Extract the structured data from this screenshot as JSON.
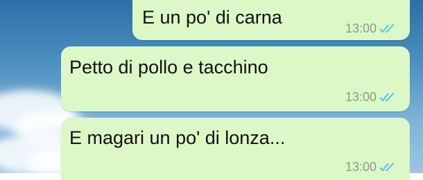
{
  "messages": [
    {
      "text": "E un po' di carna",
      "time": "13:00",
      "status_icon": "double-check-icon"
    },
    {
      "text": "Petto di pollo e tacchino",
      "time": "13:00",
      "status_icon": "double-check-icon"
    },
    {
      "text": "E magari un po' di lonza...",
      "time": "13:00",
      "status_icon": "double-check-icon"
    }
  ],
  "colors": {
    "bubble": "#dcf8c6",
    "meta_text": "#8a9a8a",
    "read_ticks": "#4fc3f7",
    "sky_top": "#2b6fa6"
  }
}
